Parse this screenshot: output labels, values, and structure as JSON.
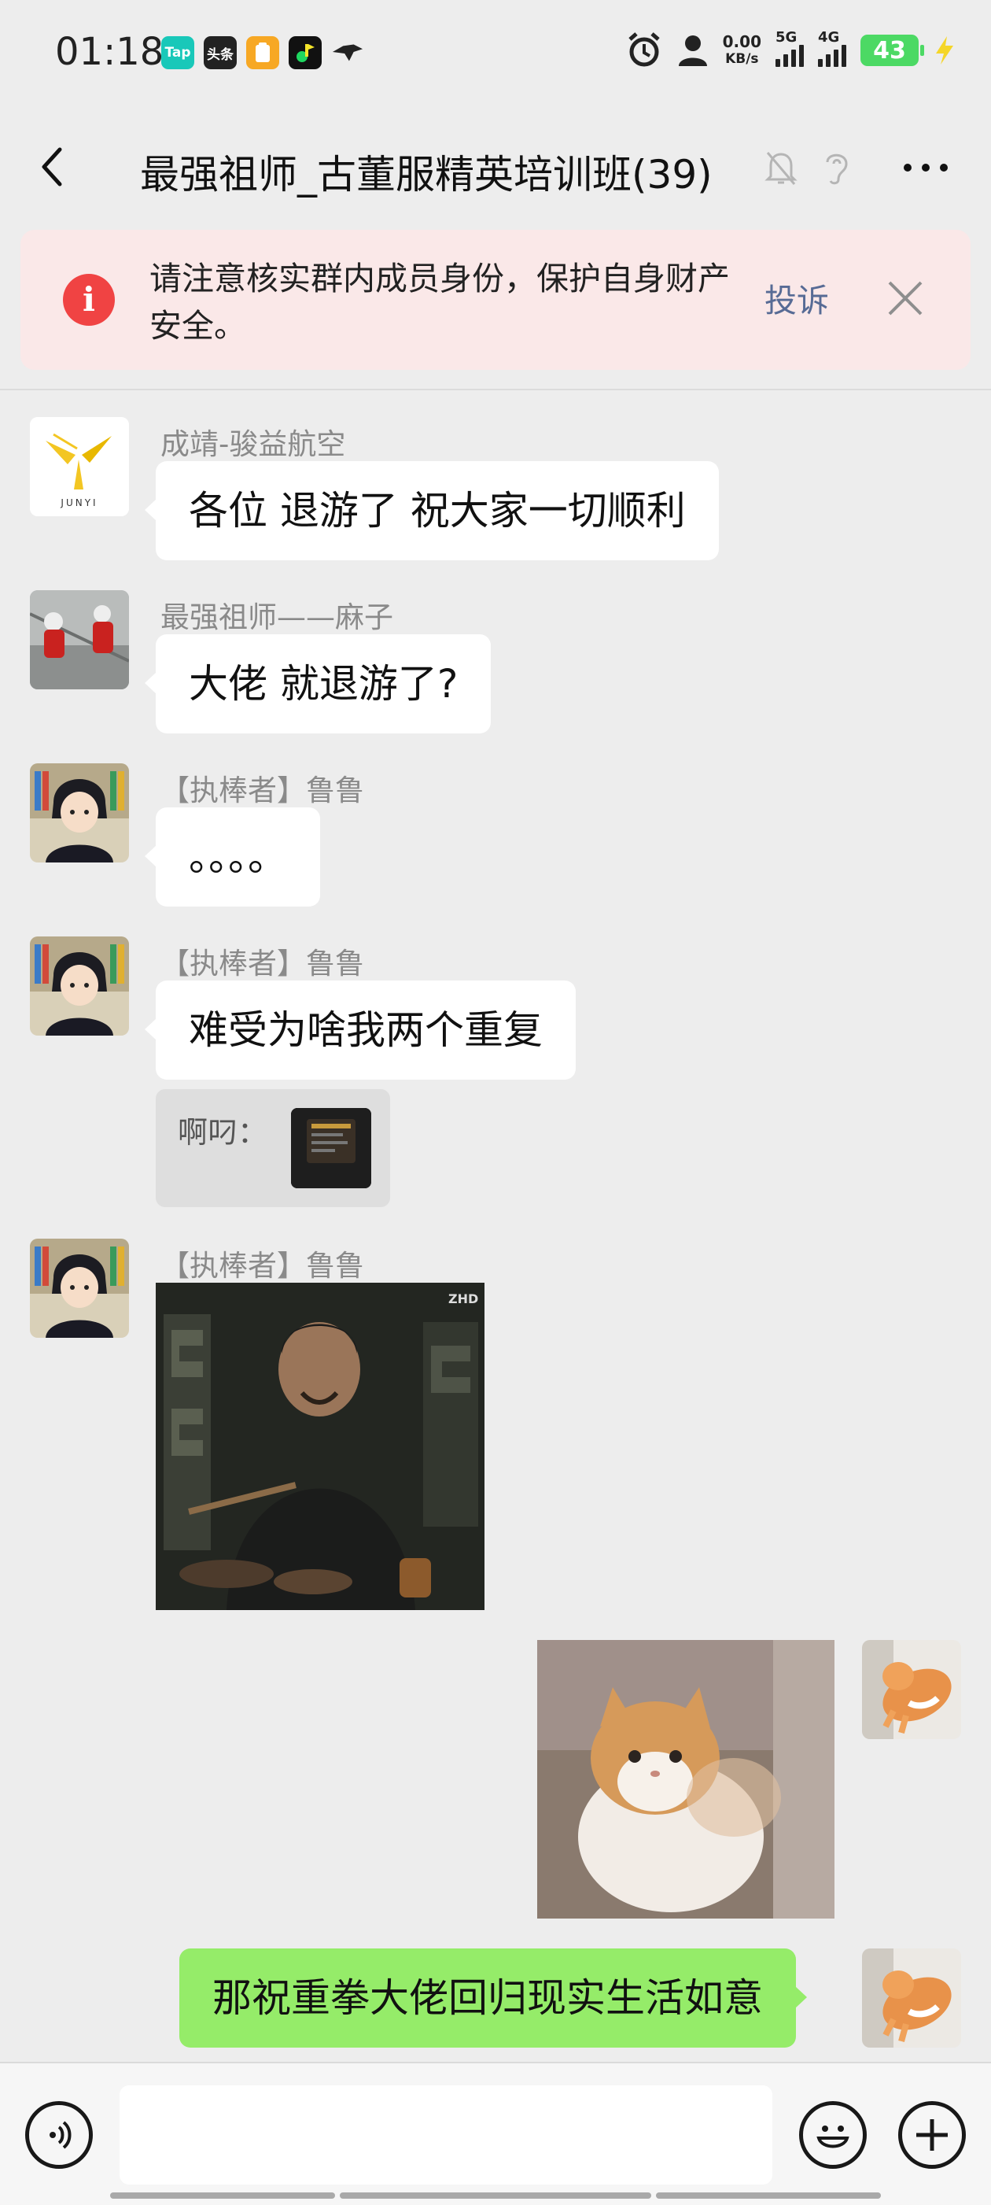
{
  "status_bar": {
    "time": "01:18",
    "apps": [
      {
        "label": "Tap",
        "color": "#19c8b9"
      },
      {
        "label": "头条",
        "color": "#222222"
      },
      {
        "label": "",
        "color": "#f7a824"
      },
      {
        "label": "",
        "color": "#111111"
      }
    ],
    "net_speed": "0.00",
    "net_unit": "KB/s",
    "signal_1": "5G",
    "signal_2": "4G",
    "battery": "43"
  },
  "header": {
    "title": "最强祖师_古董服精英培训班(39)"
  },
  "banner": {
    "text": "请注意核实群内成员身份，保护自身财产安全。",
    "report_label": "投诉"
  },
  "messages": [
    {
      "sender": "成靖-骏益航空",
      "text": "各位 退游了 祝大家一切顺利"
    },
    {
      "sender": "最强祖师——麻子",
      "text": "大佬  就退游了?"
    },
    {
      "sender": "【执棒者】鲁鲁",
      "text": "。。。。"
    },
    {
      "sender": "【执棒者】鲁鲁",
      "text": "难受为啥我两个重复",
      "quote": "啊叼："
    },
    {
      "sender": "【执棒者】鲁鲁",
      "image_caption": "ZHD"
    },
    {
      "sender": "",
      "text": "那祝重拳大佬回归现实生活如意"
    }
  ],
  "avatar_logo_text": "JUNYI",
  "input": {
    "placeholder": ""
  },
  "colors": {
    "background": "#ededed",
    "own_bubble": "#95ec69",
    "banner_bg": "#fae8e8",
    "warning_red": "#f04343",
    "link_blue": "#576b95"
  }
}
